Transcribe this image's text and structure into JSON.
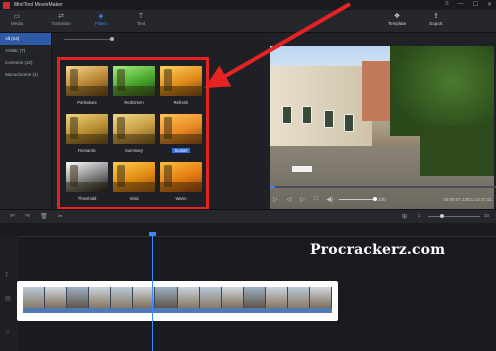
{
  "app": {
    "title": "MiniTool MovieMaker"
  },
  "window_controls": [
    "≡",
    "—",
    "☐",
    "✕"
  ],
  "toolbar": {
    "items": [
      {
        "label": "Media",
        "icon": "folder-icon"
      },
      {
        "label": "Transition",
        "icon": "transition-icon"
      },
      {
        "label": "Filters",
        "icon": "filters-icon"
      },
      {
        "label": "Text",
        "icon": "text-icon"
      }
    ],
    "active": "Filters",
    "right_items": [
      {
        "label": "Template",
        "icon": "template-icon"
      },
      {
        "label": "Export",
        "icon": "export-icon"
      }
    ]
  },
  "sidebar": {
    "items": [
      {
        "label": "All (24)"
      },
      {
        "label": "Artistic (7)"
      },
      {
        "label": "Common (10)"
      },
      {
        "label": "Monochrome (4)"
      }
    ],
    "active_index": 0
  },
  "filters": {
    "items": [
      {
        "label": "Portraiture",
        "style": "t-portrait"
      },
      {
        "label": "RedGreen",
        "style": "t-redgreen"
      },
      {
        "label": "Refresh",
        "style": "t-refresh"
      },
      {
        "label": "Romantic",
        "style": "t-romantic"
      },
      {
        "label": "Summary",
        "style": "t-summary"
      },
      {
        "label": "Sunset",
        "style": "t-sunset",
        "selected": true
      },
      {
        "label": "Threshold",
        "style": "t-threshold"
      },
      {
        "label": "Vivid",
        "style": "t-vivid"
      },
      {
        "label": "Warm",
        "style": "t-warm"
      }
    ]
  },
  "player": {
    "volume": "100",
    "timecode": "00:00:07.13/01:10:37.01",
    "progress_fraction": 0.02
  },
  "timeline": {
    "zoom_min": "1",
    "zoom_max": "10"
  },
  "watermark": "Procrackerz.com",
  "colors": {
    "accent": "#3d86ff",
    "highlight_box": "#e52322"
  }
}
